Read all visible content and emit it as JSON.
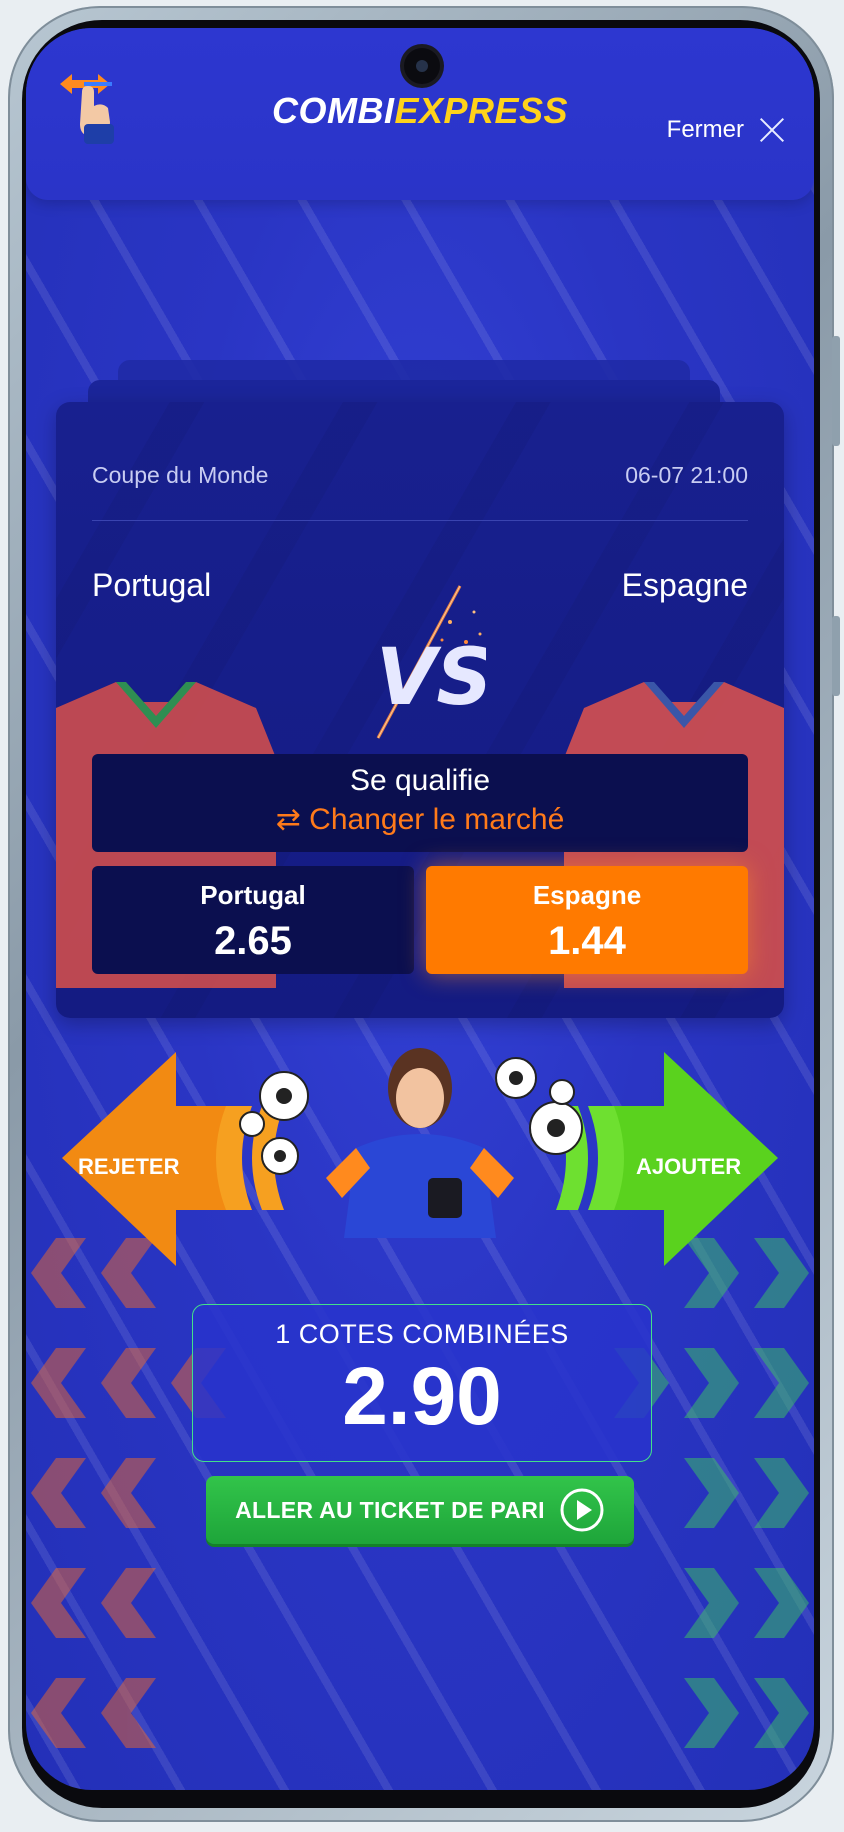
{
  "header": {
    "logo_part1": "COMBI",
    "logo_part2": "EXPRESS",
    "close_label": "Fermer"
  },
  "match": {
    "competition": "Coupe du Monde",
    "datetime": "06-07 21:00",
    "home_team": "Portugal",
    "away_team": "Espagne",
    "vs_icon": "versus-emblem"
  },
  "market": {
    "title": "Se qualifie",
    "change_label": "⇄ Changer le marché"
  },
  "odds": [
    {
      "team": "Portugal",
      "value": "2.65",
      "selected": false
    },
    {
      "team": "Espagne",
      "value": "1.44",
      "selected": true
    }
  ],
  "swipe": {
    "reject_label": "REJETER",
    "add_label": "AJOUTER"
  },
  "summary": {
    "combined_label": "1 COTES COMBINÉES",
    "combined_value": "2.90"
  },
  "cta": {
    "label": "ALLER AU TICKET DE PARI",
    "icon": "play-icon"
  },
  "colors": {
    "background": "#2a35c4",
    "accent_orange": "#ff7a00",
    "accent_green": "#2bbd46",
    "logo_yellow": "#ffd21a"
  }
}
